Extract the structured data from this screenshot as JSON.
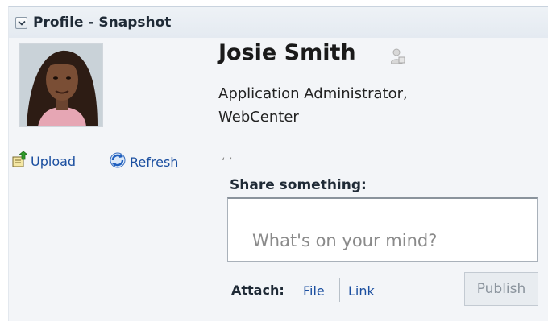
{
  "panel": {
    "title": "Profile - Snapshot",
    "collapse_icon": "chevron-down-icon"
  },
  "profile": {
    "name": "Josie Smith",
    "title": "Application Administrator, WebCenter",
    "status_quote": "‘ ’",
    "presence_icon": "offline-person-icon",
    "avatar_icon": "user-photo"
  },
  "actions": {
    "upload_label": "Upload",
    "refresh_label": "Refresh",
    "upload_icon": "upload-icon",
    "refresh_icon": "refresh-icon"
  },
  "share": {
    "label": "Share something:",
    "placeholder": "What's on your mind?",
    "value": ""
  },
  "attach": {
    "label": "Attach:",
    "file_label": "File",
    "link_label": "Link"
  },
  "publish": {
    "label": "Publish",
    "enabled": false
  },
  "colors": {
    "link": "#1b4fa0",
    "panel_bg": "#f3f5f8",
    "disabled_text": "#8b949d"
  }
}
